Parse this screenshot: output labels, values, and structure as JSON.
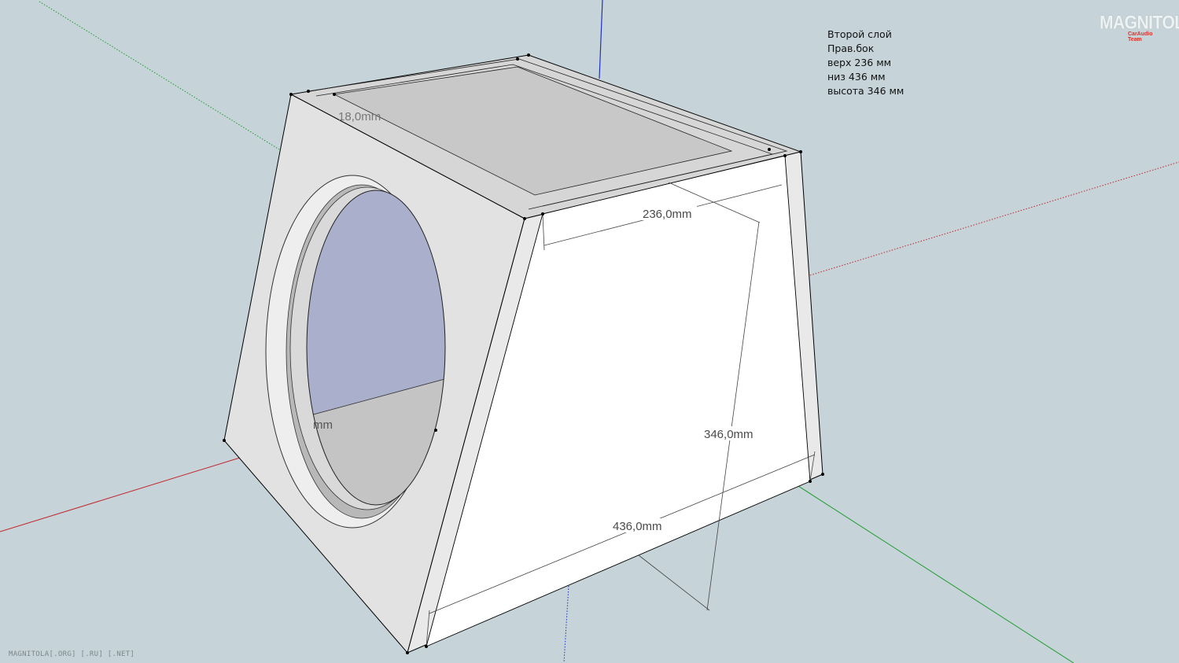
{
  "notes": {
    "line1": "Второй слой",
    "line2": "Прав.бок",
    "line3": "верх 236 мм",
    "line4": "низ 436 мм",
    "line5": "высота 346 мм"
  },
  "dimensions": {
    "top_width": "236,0mm",
    "bottom_width": "436,0mm",
    "height": "346,0mm",
    "thickness": "18,0mm",
    "hidden_partial": "mm"
  },
  "logo": {
    "main": "MAGNITOLA",
    "sub": "CarAudio Team"
  },
  "footer": "MAGNITOLA[.ORG] [.RU] [.NET]",
  "colors": {
    "background": "#c6d3d8",
    "panel_light": "#e2e2e2",
    "panel_white": "#ffffff",
    "top_face": "#c8c8c8",
    "cutout_blue": "#aab0cc",
    "cutout_gray": "#c4c4c4",
    "axis_red": "#c0272d",
    "axis_green": "#1c9c2c",
    "axis_blue": "#2030c0"
  }
}
